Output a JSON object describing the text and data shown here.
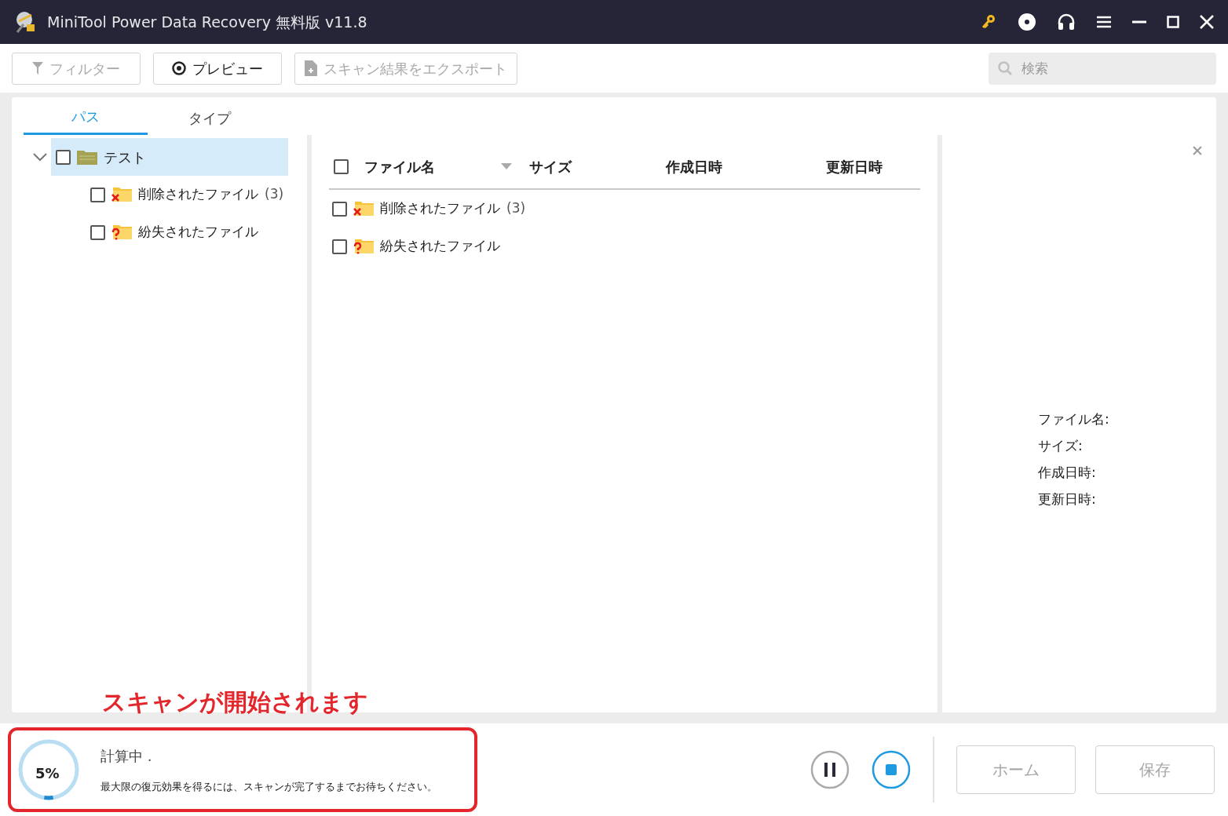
{
  "window": {
    "title": "MiniTool Power Data Recovery 無料版 v11.8"
  },
  "title_controls": [
    {
      "kind": "key"
    },
    {
      "kind": "disc"
    },
    {
      "kind": "headset"
    },
    {
      "kind": "menu"
    },
    {
      "kind": "minimize"
    },
    {
      "kind": "maximize"
    },
    {
      "kind": "close"
    }
  ],
  "toolbar": [
    {
      "label": "フィルター",
      "kind": "filter",
      "disabled": true
    },
    {
      "label": "プレビュー",
      "kind": "preview",
      "disabled": false
    },
    {
      "label": "スキャン結果をエクスポート",
      "kind": "export",
      "disabled": true
    }
  ],
  "search": {
    "placeholder": "検索"
  },
  "tabs": [
    {
      "label": "パス",
      "selected": true
    },
    {
      "label": "タイプ",
      "selected": false
    }
  ],
  "tree": [
    {
      "label": "テスト",
      "kind": "folder",
      "checked": false,
      "expanded": true,
      "selected": true,
      "children": [
        {
          "label": "削除されたファイル",
          "count": "(3)",
          "kind": "deleted",
          "checked": false,
          "selected": false
        },
        {
          "label": "紛失されたファイル",
          "kind": "lost",
          "checked": false,
          "selected": false
        }
      ]
    }
  ],
  "table": {
    "columns": [
      {
        "label": "ファイル名",
        "sortable": true
      },
      {
        "label": "サイズ",
        "sortable": false
      },
      {
        "label": "作成日時",
        "sortable": false
      },
      {
        "label": "更新日時",
        "sortable": false
      }
    ],
    "header_checked": false,
    "rows": [
      {
        "label": "削除されたファイル",
        "count": "(3)",
        "kind": "deleted",
        "checked": false
      },
      {
        "label": "紛失されたファイル",
        "kind": "lost",
        "checked": false
      }
    ]
  },
  "details": {
    "fields": [
      "ファイル名:",
      "サイズ:",
      "作成日時:",
      "更新日時:"
    ]
  },
  "annotation": {
    "text": "スキャンが開始されます"
  },
  "status": {
    "percent": "5%",
    "level": 0.05,
    "title": "計算中 .",
    "message": "最大限の復元効果を得るには、スキャンが完了するまでお待ちください。"
  },
  "scan_controls": [
    {
      "kind": "pause"
    },
    {
      "kind": "stop"
    }
  ],
  "buttons": [
    {
      "label": "ホーム",
      "disabled": true
    },
    {
      "label": "保存",
      "disabled": true
    }
  ]
}
